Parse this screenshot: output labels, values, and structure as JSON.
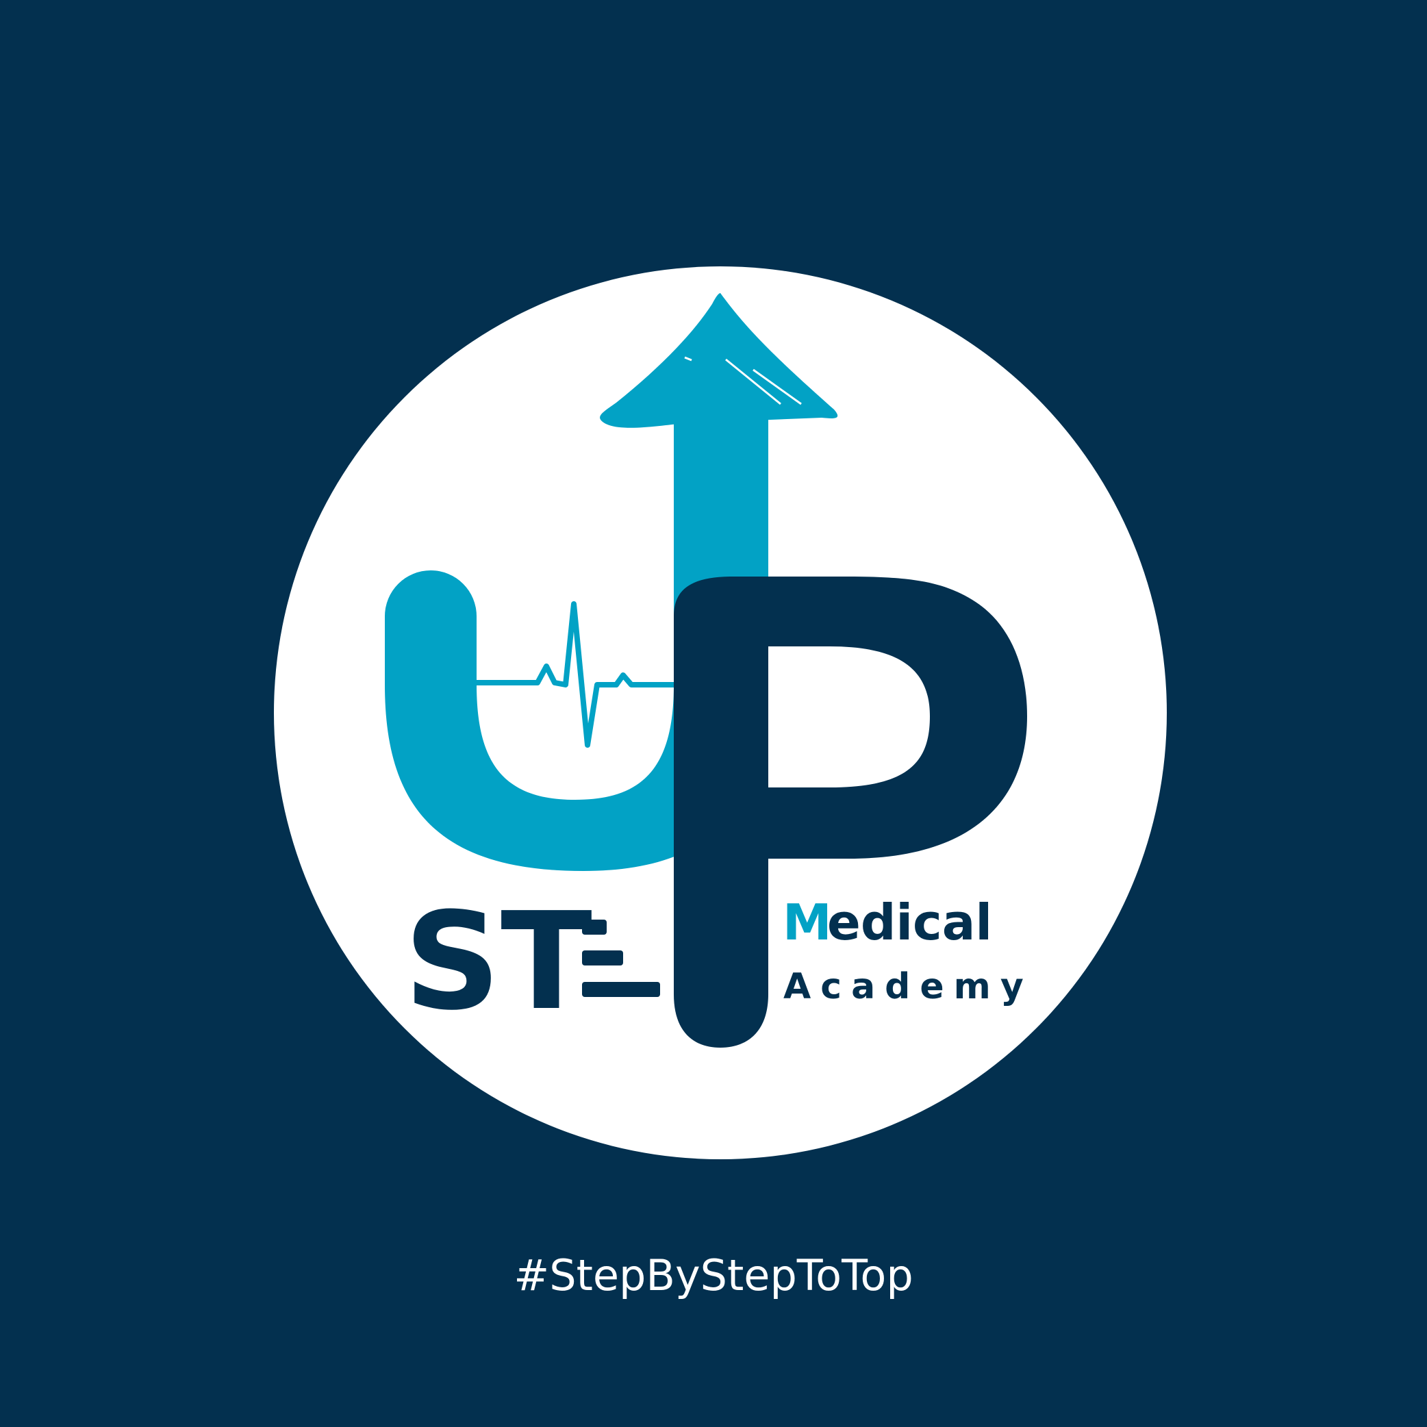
{
  "colors": {
    "background": "#03304f",
    "circle": "#ffffff",
    "accent": "#02a2c5",
    "dark": "#03304f"
  },
  "logo": {
    "name": "STEP Medical Academy",
    "word_step_visible": "ST",
    "letter_p": "P",
    "medical_initial": "M",
    "medical_rest": "edical",
    "academy": "Academy",
    "icons": [
      "up-arrow-icon",
      "heartbeat-icon"
    ]
  },
  "hashtag": "#StepByStepToTop"
}
